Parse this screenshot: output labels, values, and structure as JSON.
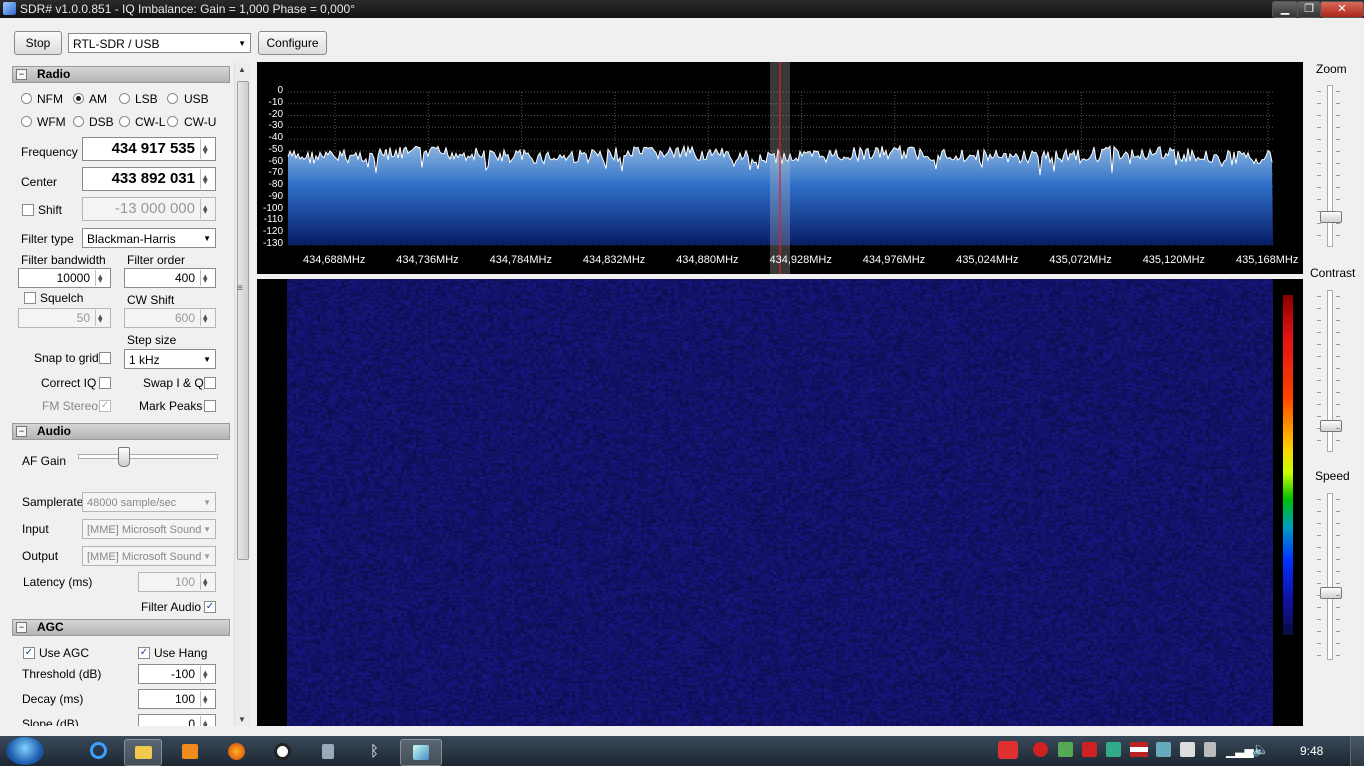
{
  "window": {
    "title": "SDR# v1.0.0.851 - IQ Imbalance: Gain = 1,000 Phase = 0,000°"
  },
  "toolbar": {
    "stop_label": "Stop",
    "device": "RTL-SDR / USB",
    "configure_label": "Configure"
  },
  "radio": {
    "section_title": "Radio",
    "modes": [
      "NFM",
      "AM",
      "LSB",
      "USB",
      "WFM",
      "DSB",
      "CW-L",
      "CW-U"
    ],
    "selected_mode": "AM",
    "frequency_label": "Frequency",
    "frequency": "434 917 535",
    "center_label": "Center",
    "center": "433 892 031",
    "shift_label": "Shift",
    "shift": "-13 000 000",
    "filter_type_label": "Filter type",
    "filter_type": "Blackman-Harris",
    "filter_bandwidth_label": "Filter bandwidth",
    "filter_bandwidth": "10000",
    "filter_order_label": "Filter order",
    "filter_order": "400",
    "squelch_label": "Squelch",
    "squelch": "50",
    "cw_shift_label": "CW Shift",
    "cw_shift": "600",
    "step_size_label": "Step size",
    "step_size": "1 kHz",
    "snap_label": "Snap to grid",
    "correct_iq_label": "Correct IQ",
    "swap_iq_label": "Swap I & Q",
    "fm_stereo_label": "FM Stereo",
    "mark_peaks_label": "Mark Peaks"
  },
  "audio": {
    "section_title": "Audio",
    "af_gain_label": "AF Gain",
    "samplerate_label": "Samplerate",
    "samplerate": "48000 sample/sec",
    "input_label": "Input",
    "input": "[MME] Microsoft Sound",
    "output_label": "Output",
    "output": "[MME] Microsoft Sound",
    "latency_label": "Latency (ms)",
    "latency": "100",
    "filter_audio_label": "Filter Audio"
  },
  "agc": {
    "section_title": "AGC",
    "use_agc_label": "Use AGC",
    "use_hang_label": "Use Hang",
    "threshold_label": "Threshold (dB)",
    "threshold": "-100",
    "decay_label": "Decay (ms)",
    "decay": "100",
    "slope_label": "Slope (dB)",
    "slope": "0"
  },
  "spectrum": {
    "y_ticks": [
      "0",
      "-10",
      "-20",
      "-30",
      "-40",
      "-50",
      "-60",
      "-70",
      "-80",
      "-90",
      "-100",
      "-110",
      "-120",
      "-130"
    ],
    "x_ticks": [
      "434,688MHz",
      "434,736MHz",
      "434,784MHz",
      "434,832MHz",
      "434,880MHz",
      "434,928MHz",
      "434,976MHz",
      "435,024MHz",
      "435,072MHz",
      "435,120MHz",
      "435,168MHz"
    ]
  },
  "right_panel": {
    "zoom_label": "Zoom",
    "contrast_label": "Contrast",
    "speed_label": "Speed"
  },
  "taskbar": {
    "clock": "9:48"
  },
  "colors": {
    "spectrum_fill_top": "#6a9fd4",
    "spectrum_fill_bottom": "#0a2a7a",
    "waterfall_bg": "#13136a",
    "tuning_line": "#e02020"
  }
}
